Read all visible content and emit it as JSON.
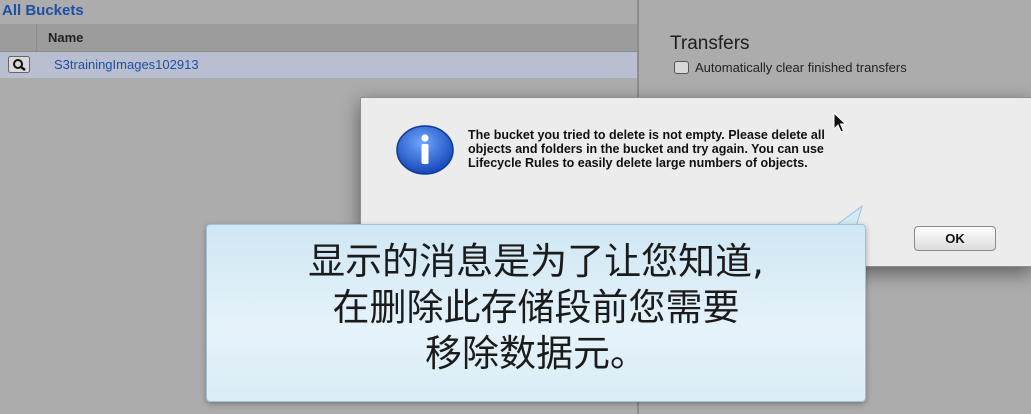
{
  "left_panel": {
    "title": "All Buckets",
    "column_header": "Name",
    "buckets": [
      {
        "name": "S3trainingImages102913",
        "icon": "magnifier-icon"
      }
    ]
  },
  "right_panel": {
    "title": "Transfers",
    "auto_clear_label": "Automatically clear finished transfers",
    "auto_clear_checked": false
  },
  "dialog": {
    "icon": "info-icon",
    "message": "The bucket you tried to delete is not empty. Please delete all\nobjects and folders in the bucket and try again. You can use\nLifecycle Rules to easily delete large numbers of objects.",
    "ok_label": "OK"
  },
  "callout": {
    "text": "显示的消息是为了让您知道,\n在删除此存储段前您需要\n移除数据元。"
  },
  "colors": {
    "link_blue": "#1f4fa3",
    "info_blue": "#1b5fd1",
    "panel_gray": "#acacac"
  }
}
